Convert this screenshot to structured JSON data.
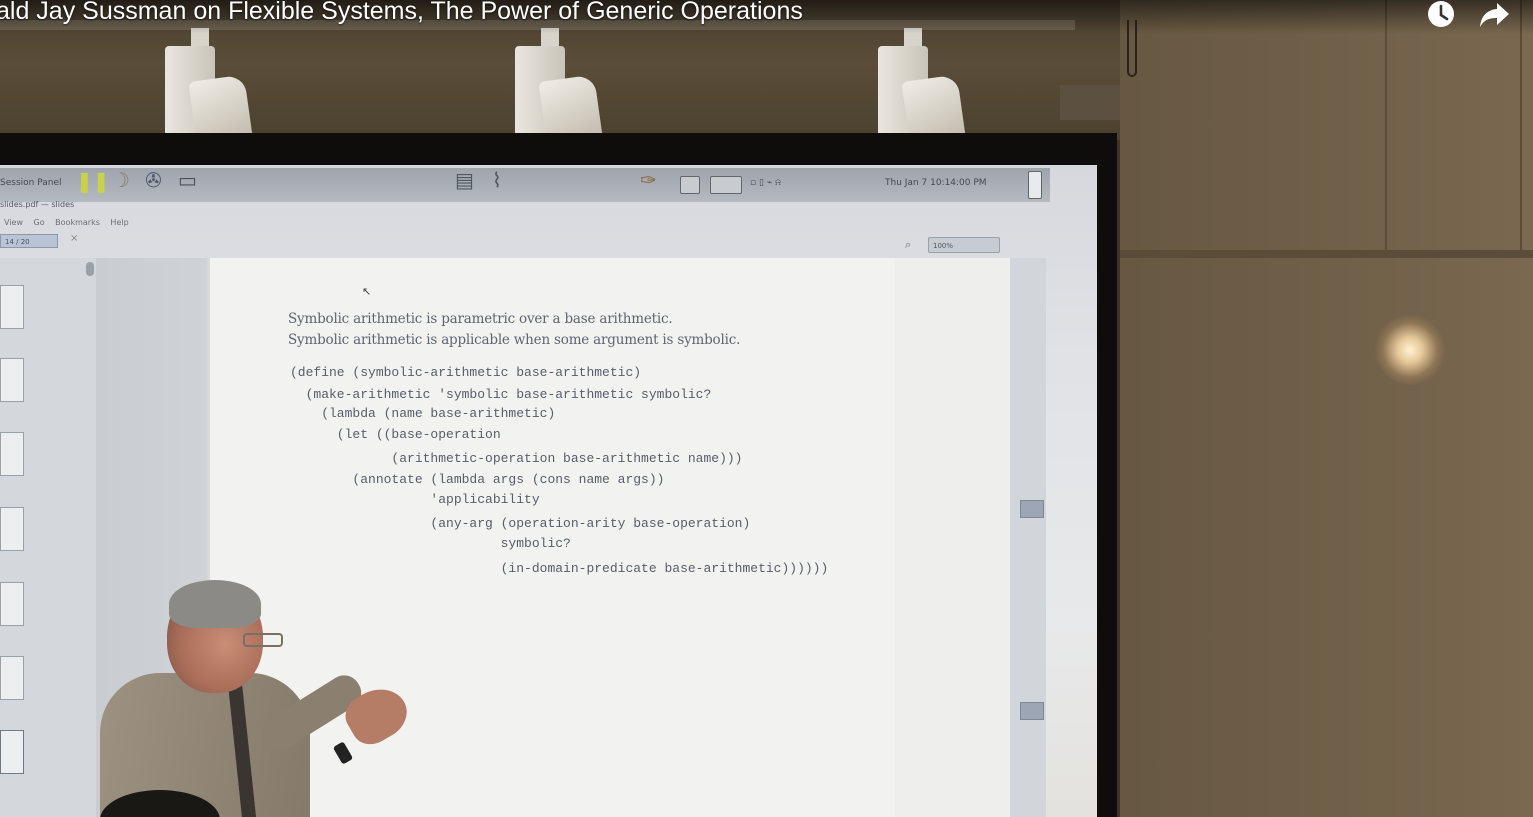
{
  "video": {
    "title": "ald Jay Sussman on Flexible Systems, The Power of Generic Operations",
    "watch_later_icon": "clock-icon",
    "share_icon": "share-arrow-icon"
  },
  "projected_desktop": {
    "panel_label": "Session Panel",
    "window_title": "slides.pdf — slides",
    "menu": [
      "View",
      "Go",
      "Bookmarks",
      "Help"
    ],
    "page_field": "14 / 20",
    "zoom": "100%",
    "tray_time": "Thu Jan 7 10:14:00 PM"
  },
  "slide": {
    "lines": [
      "Symbolic arithmetic is parametric over a base arithmetic.",
      "Symbolic arithmetic is applicable when some argument is symbolic."
    ],
    "code": [
      "(define (symbolic-arithmetic base-arithmetic)",
      "  (make-arithmetic 'symbolic base-arithmetic symbolic?",
      "    (lambda (name base-arithmetic)",
      "      (let ((base-operation",
      "             (arithmetic-operation base-arithmetic name)))",
      "        (annotate (lambda args (cons name args))",
      "                  'applicability",
      "                  (any-arg (operation-arity base-operation)",
      "                           symbolic?",
      "                           (in-domain-predicate base-arithmetic))))))"
    ]
  },
  "colors": {
    "screen": "#e3e4e6",
    "wall": "#6e5e47",
    "title_text": "#ffffff"
  }
}
